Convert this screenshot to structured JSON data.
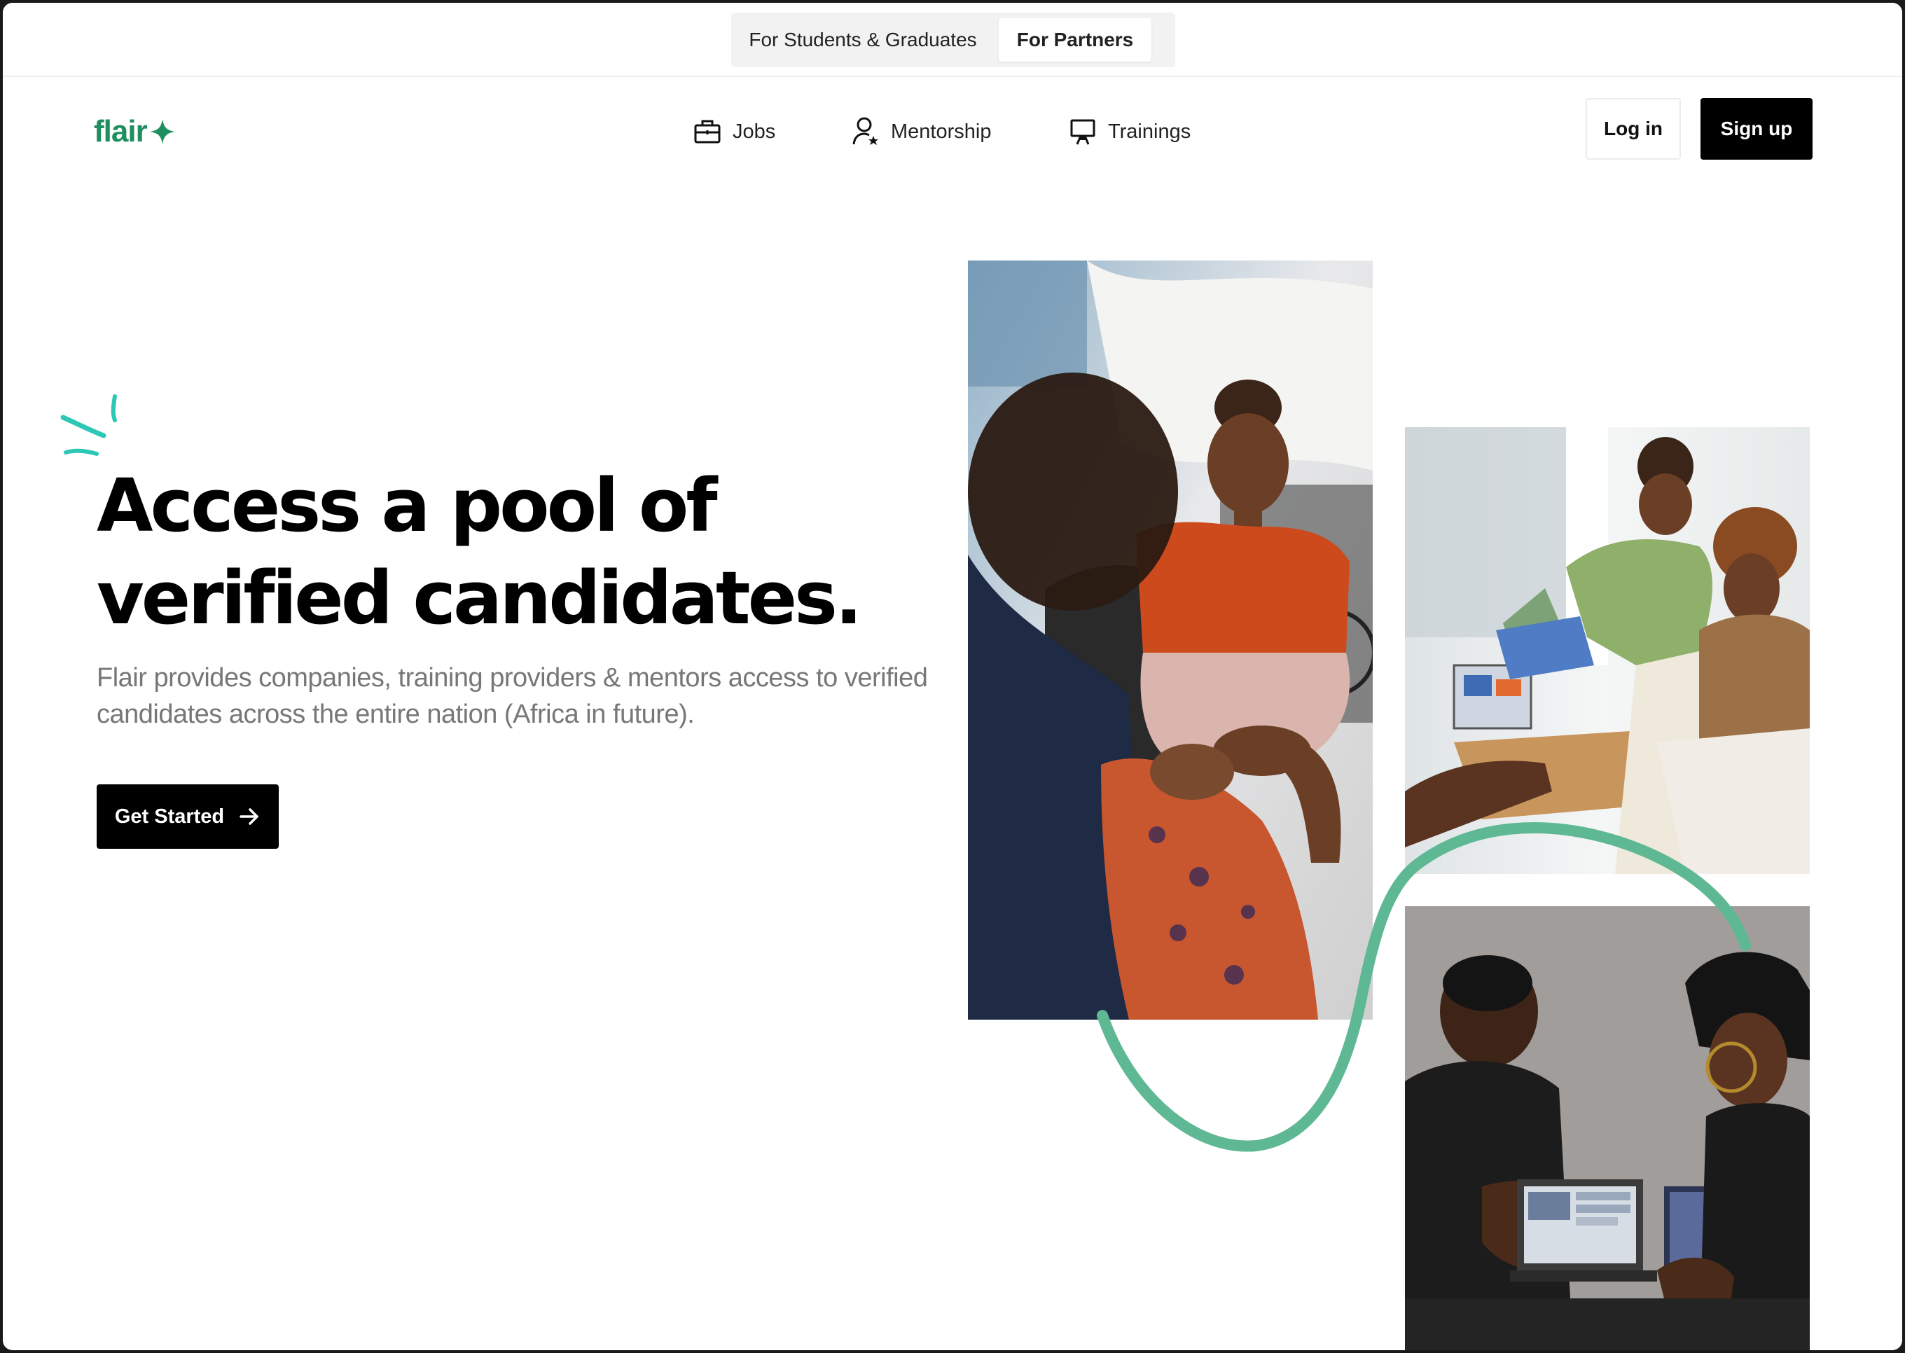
{
  "audience_switch": {
    "students_label": "For Students & Graduates",
    "partners_label": "For Partners",
    "active": "For Partners"
  },
  "brand": {
    "logo_text": "flair",
    "accent_color": "#1f8f5f",
    "sparkle_color": "#2cc7b5",
    "squiggle_color": "#5fb894"
  },
  "nav": {
    "items": [
      {
        "label": "Jobs",
        "icon": "briefcase-icon"
      },
      {
        "label": "Mentorship",
        "icon": "user-star-icon"
      },
      {
        "label": "Trainings",
        "icon": "presentation-icon"
      }
    ],
    "login_label": "Log in",
    "signup_label": "Sign up"
  },
  "hero": {
    "title_line1": "Access a pool of",
    "title_line2": "verified candidates.",
    "description": "Flair provides companies, training providers & mentors access to verified candidates across the entire nation (Africa in future).",
    "cta_label": "Get Started",
    "cta_icon": "arrow-right-icon"
  },
  "photos": [
    {
      "name": "conversation-photo"
    },
    {
      "name": "team-meeting-photo"
    },
    {
      "name": "laptop-collaboration-photo"
    }
  ]
}
